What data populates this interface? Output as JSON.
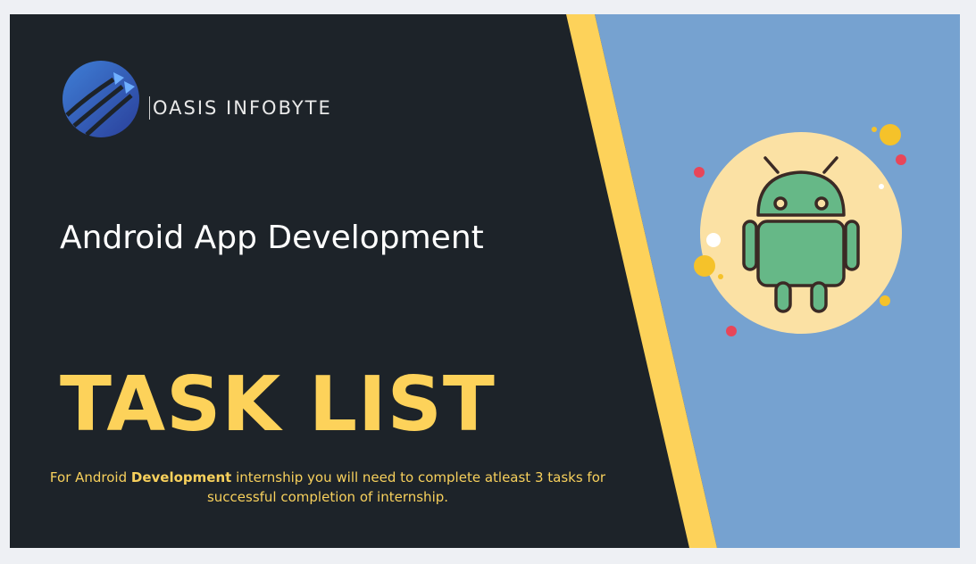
{
  "brand": {
    "name": "OASIS INFOBYTE"
  },
  "heading": {
    "subtitle": "Android App Development",
    "title": "TASK LIST"
  },
  "description": {
    "lead": "For Android ",
    "bold": "Development",
    "rest": " internship you will need to complete atleast 3 tasks for successful completion of internship."
  },
  "colors": {
    "dark_panel": "#1d2329",
    "blue_panel": "#76a2d0",
    "yellow_stripe": "#fdd25a",
    "title_yellow": "#fdd25a",
    "android_green": "#66b887",
    "circle_cream": "#fbe1a4"
  },
  "icons": {
    "logo": "globe-arrows-logo",
    "android": "android-robot-icon"
  }
}
